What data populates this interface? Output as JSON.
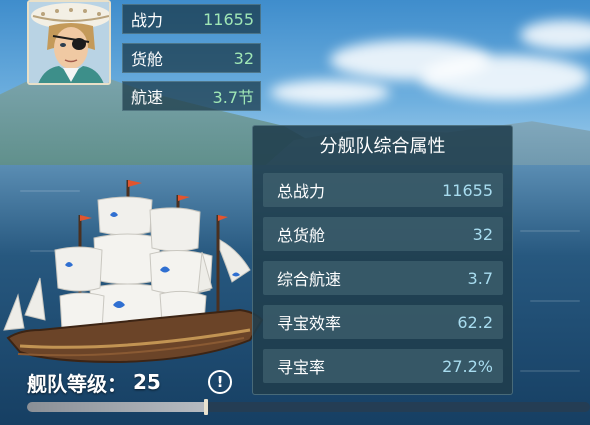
{
  "top_stats": [
    {
      "label": "战力",
      "value": "11655"
    },
    {
      "label": "货舱",
      "value": "32"
    },
    {
      "label": "航速",
      "value": "3.7节"
    }
  ],
  "panel": {
    "title": "分舰队综合属性",
    "rows": [
      {
        "label": "总战力",
        "value": "11655"
      },
      {
        "label": "总货舱",
        "value": "32"
      },
      {
        "label": "综合航速",
        "value": "3.7"
      },
      {
        "label": "寻宝效率",
        "value": "62.2"
      },
      {
        "label": "寻宝率",
        "value": "27.2%"
      }
    ]
  },
  "fleet": {
    "label": "舰队等级：",
    "level": "25",
    "info_icon": "!",
    "progress_fraction": 0.32
  },
  "colors": {
    "stat_value": "#9fe6b5",
    "panel_value": "#a8dcef",
    "panel_bg": "#203e4c"
  },
  "icons": {
    "avatar": "captain-portrait",
    "info": "info-icon"
  }
}
